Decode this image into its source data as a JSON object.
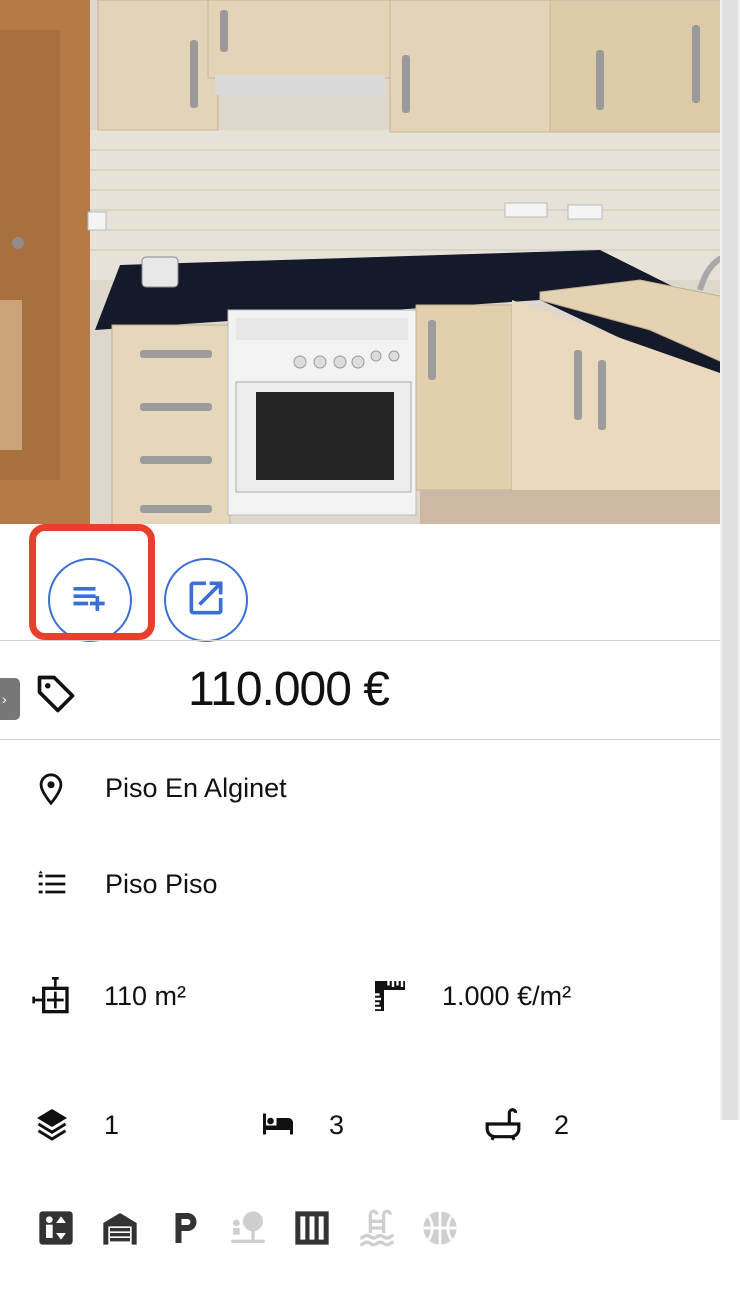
{
  "listing": {
    "price": "110.000 €",
    "location": "Piso En Alginet",
    "property_type": "Piso Piso",
    "area": "110 m²",
    "price_per_m2": "1.000 €/m²",
    "floor": "1",
    "bedrooms": "3",
    "bathrooms": "2"
  },
  "actions": [
    {
      "name": "add-to-list",
      "icon": "playlist-add-icon",
      "highlighted": true
    },
    {
      "name": "open-external",
      "icon": "open-in-new-icon",
      "highlighted": false
    }
  ],
  "amenities": [
    {
      "icon": "elevator-icon",
      "active": true
    },
    {
      "icon": "garage-icon",
      "active": true
    },
    {
      "icon": "parking-icon",
      "active": true
    },
    {
      "icon": "garden-icon",
      "active": false
    },
    {
      "icon": "closet-icon",
      "active": true
    },
    {
      "icon": "pool-icon",
      "active": false
    },
    {
      "icon": "sports-icon",
      "active": false
    }
  ],
  "colors": {
    "accent": "#3a6fd8",
    "highlight": "#e8402c",
    "amenity_active": "#333333",
    "amenity_inactive": "#cfcfcf"
  }
}
